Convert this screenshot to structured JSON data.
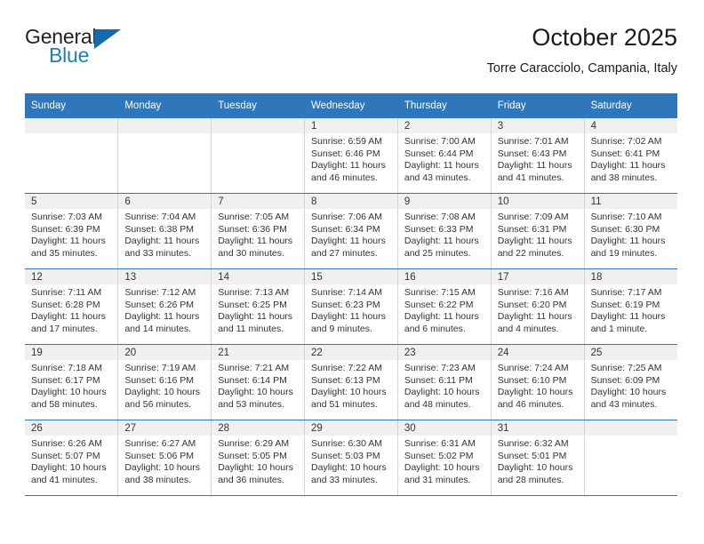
{
  "brand": {
    "name_top": "General",
    "name_bottom": "Blue",
    "triangle_icon": "triangle-logo-icon",
    "color_dark": "#231f20",
    "color_blue": "#1c7fc4"
  },
  "header": {
    "title": "October 2025",
    "subtitle": "Torre Caracciolo, Campania, Italy"
  },
  "theme": {
    "header_blue": "#2f76bb",
    "daynum_band": "#f0f0f0",
    "grid_line": "#d4d4d4",
    "text": "#333333"
  },
  "calendar": {
    "weekday_headers": [
      "Sunday",
      "Monday",
      "Tuesday",
      "Wednesday",
      "Thursday",
      "Friday",
      "Saturday"
    ],
    "weeks": [
      [
        {
          "empty": true
        },
        {
          "empty": true
        },
        {
          "empty": true
        },
        {
          "day": "1",
          "sunrise": "Sunrise: 6:59 AM",
          "sunset": "Sunset: 6:46 PM",
          "daylight1": "Daylight: 11 hours",
          "daylight2": "and 46 minutes."
        },
        {
          "day": "2",
          "sunrise": "Sunrise: 7:00 AM",
          "sunset": "Sunset: 6:44 PM",
          "daylight1": "Daylight: 11 hours",
          "daylight2": "and 43 minutes."
        },
        {
          "day": "3",
          "sunrise": "Sunrise: 7:01 AM",
          "sunset": "Sunset: 6:43 PM",
          "daylight1": "Daylight: 11 hours",
          "daylight2": "and 41 minutes."
        },
        {
          "day": "4",
          "sunrise": "Sunrise: 7:02 AM",
          "sunset": "Sunset: 6:41 PM",
          "daylight1": "Daylight: 11 hours",
          "daylight2": "and 38 minutes."
        }
      ],
      [
        {
          "day": "5",
          "sunrise": "Sunrise: 7:03 AM",
          "sunset": "Sunset: 6:39 PM",
          "daylight1": "Daylight: 11 hours",
          "daylight2": "and 35 minutes."
        },
        {
          "day": "6",
          "sunrise": "Sunrise: 7:04 AM",
          "sunset": "Sunset: 6:38 PM",
          "daylight1": "Daylight: 11 hours",
          "daylight2": "and 33 minutes."
        },
        {
          "day": "7",
          "sunrise": "Sunrise: 7:05 AM",
          "sunset": "Sunset: 6:36 PM",
          "daylight1": "Daylight: 11 hours",
          "daylight2": "and 30 minutes."
        },
        {
          "day": "8",
          "sunrise": "Sunrise: 7:06 AM",
          "sunset": "Sunset: 6:34 PM",
          "daylight1": "Daylight: 11 hours",
          "daylight2": "and 27 minutes."
        },
        {
          "day": "9",
          "sunrise": "Sunrise: 7:08 AM",
          "sunset": "Sunset: 6:33 PM",
          "daylight1": "Daylight: 11 hours",
          "daylight2": "and 25 minutes."
        },
        {
          "day": "10",
          "sunrise": "Sunrise: 7:09 AM",
          "sunset": "Sunset: 6:31 PM",
          "daylight1": "Daylight: 11 hours",
          "daylight2": "and 22 minutes."
        },
        {
          "day": "11",
          "sunrise": "Sunrise: 7:10 AM",
          "sunset": "Sunset: 6:30 PM",
          "daylight1": "Daylight: 11 hours",
          "daylight2": "and 19 minutes."
        }
      ],
      [
        {
          "day": "12",
          "sunrise": "Sunrise: 7:11 AM",
          "sunset": "Sunset: 6:28 PM",
          "daylight1": "Daylight: 11 hours",
          "daylight2": "and 17 minutes."
        },
        {
          "day": "13",
          "sunrise": "Sunrise: 7:12 AM",
          "sunset": "Sunset: 6:26 PM",
          "daylight1": "Daylight: 11 hours",
          "daylight2": "and 14 minutes."
        },
        {
          "day": "14",
          "sunrise": "Sunrise: 7:13 AM",
          "sunset": "Sunset: 6:25 PM",
          "daylight1": "Daylight: 11 hours",
          "daylight2": "and 11 minutes."
        },
        {
          "day": "15",
          "sunrise": "Sunrise: 7:14 AM",
          "sunset": "Sunset: 6:23 PM",
          "daylight1": "Daylight: 11 hours",
          "daylight2": "and 9 minutes."
        },
        {
          "day": "16",
          "sunrise": "Sunrise: 7:15 AM",
          "sunset": "Sunset: 6:22 PM",
          "daylight1": "Daylight: 11 hours",
          "daylight2": "and 6 minutes."
        },
        {
          "day": "17",
          "sunrise": "Sunrise: 7:16 AM",
          "sunset": "Sunset: 6:20 PM",
          "daylight1": "Daylight: 11 hours",
          "daylight2": "and 4 minutes."
        },
        {
          "day": "18",
          "sunrise": "Sunrise: 7:17 AM",
          "sunset": "Sunset: 6:19 PM",
          "daylight1": "Daylight: 11 hours",
          "daylight2": "and 1 minute."
        }
      ],
      [
        {
          "day": "19",
          "sunrise": "Sunrise: 7:18 AM",
          "sunset": "Sunset: 6:17 PM",
          "daylight1": "Daylight: 10 hours",
          "daylight2": "and 58 minutes."
        },
        {
          "day": "20",
          "sunrise": "Sunrise: 7:19 AM",
          "sunset": "Sunset: 6:16 PM",
          "daylight1": "Daylight: 10 hours",
          "daylight2": "and 56 minutes."
        },
        {
          "day": "21",
          "sunrise": "Sunrise: 7:21 AM",
          "sunset": "Sunset: 6:14 PM",
          "daylight1": "Daylight: 10 hours",
          "daylight2": "and 53 minutes."
        },
        {
          "day": "22",
          "sunrise": "Sunrise: 7:22 AM",
          "sunset": "Sunset: 6:13 PM",
          "daylight1": "Daylight: 10 hours",
          "daylight2": "and 51 minutes."
        },
        {
          "day": "23",
          "sunrise": "Sunrise: 7:23 AM",
          "sunset": "Sunset: 6:11 PM",
          "daylight1": "Daylight: 10 hours",
          "daylight2": "and 48 minutes."
        },
        {
          "day": "24",
          "sunrise": "Sunrise: 7:24 AM",
          "sunset": "Sunset: 6:10 PM",
          "daylight1": "Daylight: 10 hours",
          "daylight2": "and 46 minutes."
        },
        {
          "day": "25",
          "sunrise": "Sunrise: 7:25 AM",
          "sunset": "Sunset: 6:09 PM",
          "daylight1": "Daylight: 10 hours",
          "daylight2": "and 43 minutes."
        }
      ],
      [
        {
          "day": "26",
          "sunrise": "Sunrise: 6:26 AM",
          "sunset": "Sunset: 5:07 PM",
          "daylight1": "Daylight: 10 hours",
          "daylight2": "and 41 minutes."
        },
        {
          "day": "27",
          "sunrise": "Sunrise: 6:27 AM",
          "sunset": "Sunset: 5:06 PM",
          "daylight1": "Daylight: 10 hours",
          "daylight2": "and 38 minutes."
        },
        {
          "day": "28",
          "sunrise": "Sunrise: 6:29 AM",
          "sunset": "Sunset: 5:05 PM",
          "daylight1": "Daylight: 10 hours",
          "daylight2": "and 36 minutes."
        },
        {
          "day": "29",
          "sunrise": "Sunrise: 6:30 AM",
          "sunset": "Sunset: 5:03 PM",
          "daylight1": "Daylight: 10 hours",
          "daylight2": "and 33 minutes."
        },
        {
          "day": "30",
          "sunrise": "Sunrise: 6:31 AM",
          "sunset": "Sunset: 5:02 PM",
          "daylight1": "Daylight: 10 hours",
          "daylight2": "and 31 minutes."
        },
        {
          "day": "31",
          "sunrise": "Sunrise: 6:32 AM",
          "sunset": "Sunset: 5:01 PM",
          "daylight1": "Daylight: 10 hours",
          "daylight2": "and 28 minutes."
        },
        {
          "empty": true
        }
      ]
    ]
  }
}
